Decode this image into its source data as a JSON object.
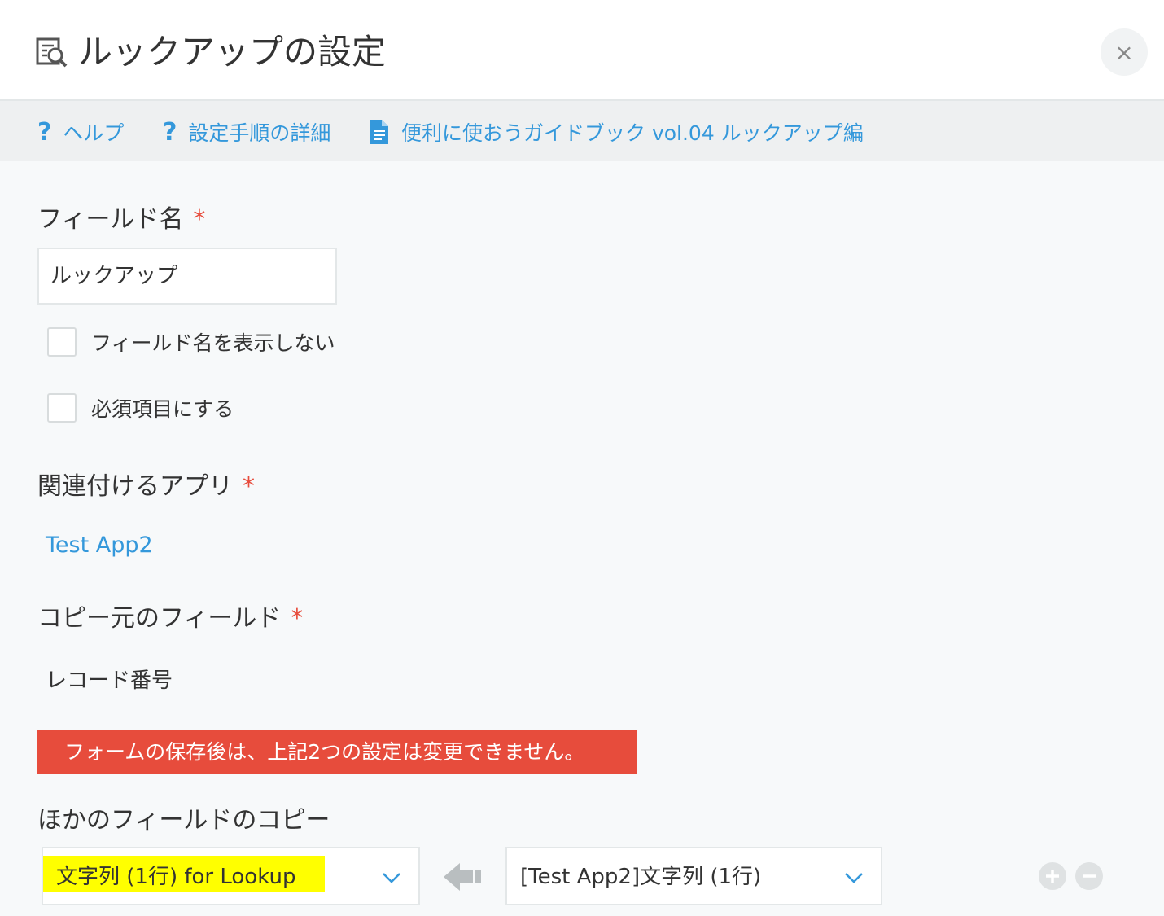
{
  "dialog": {
    "title": "ルックアップの設定",
    "close_label": "×"
  },
  "help_links": [
    {
      "icon": "question-icon",
      "label": "ヘルプ"
    },
    {
      "icon": "question-icon",
      "label": "設定手順の詳細"
    },
    {
      "icon": "document-icon",
      "label": "便利に使おうガイドブック vol.04 ルックアップ編"
    }
  ],
  "help_symbol": "?",
  "required_mark": "*",
  "field_name": {
    "label": "フィールド名",
    "value": "ルックアップ"
  },
  "options": [
    {
      "label": "フィールド名を表示しない",
      "checked": false
    },
    {
      "label": "必須項目にする",
      "checked": false
    }
  ],
  "related_app": {
    "label": "関連付けるアプリ",
    "value": "Test App2"
  },
  "source_field": {
    "label": "コピー元のフィールド",
    "value": "レコード番号"
  },
  "warning": "フォームの保存後は、上記2つの設定は変更できません。",
  "copy_fields": {
    "label": "ほかのフィールドのコピー",
    "target": "文字列 (1行) for Lookup",
    "source": "[Test App2]文字列 (1行)",
    "highlight_color": "#ffff00"
  },
  "colors": {
    "accent": "#3498db",
    "required": "#e74c3c",
    "warning_bg": "#e74c3c"
  }
}
